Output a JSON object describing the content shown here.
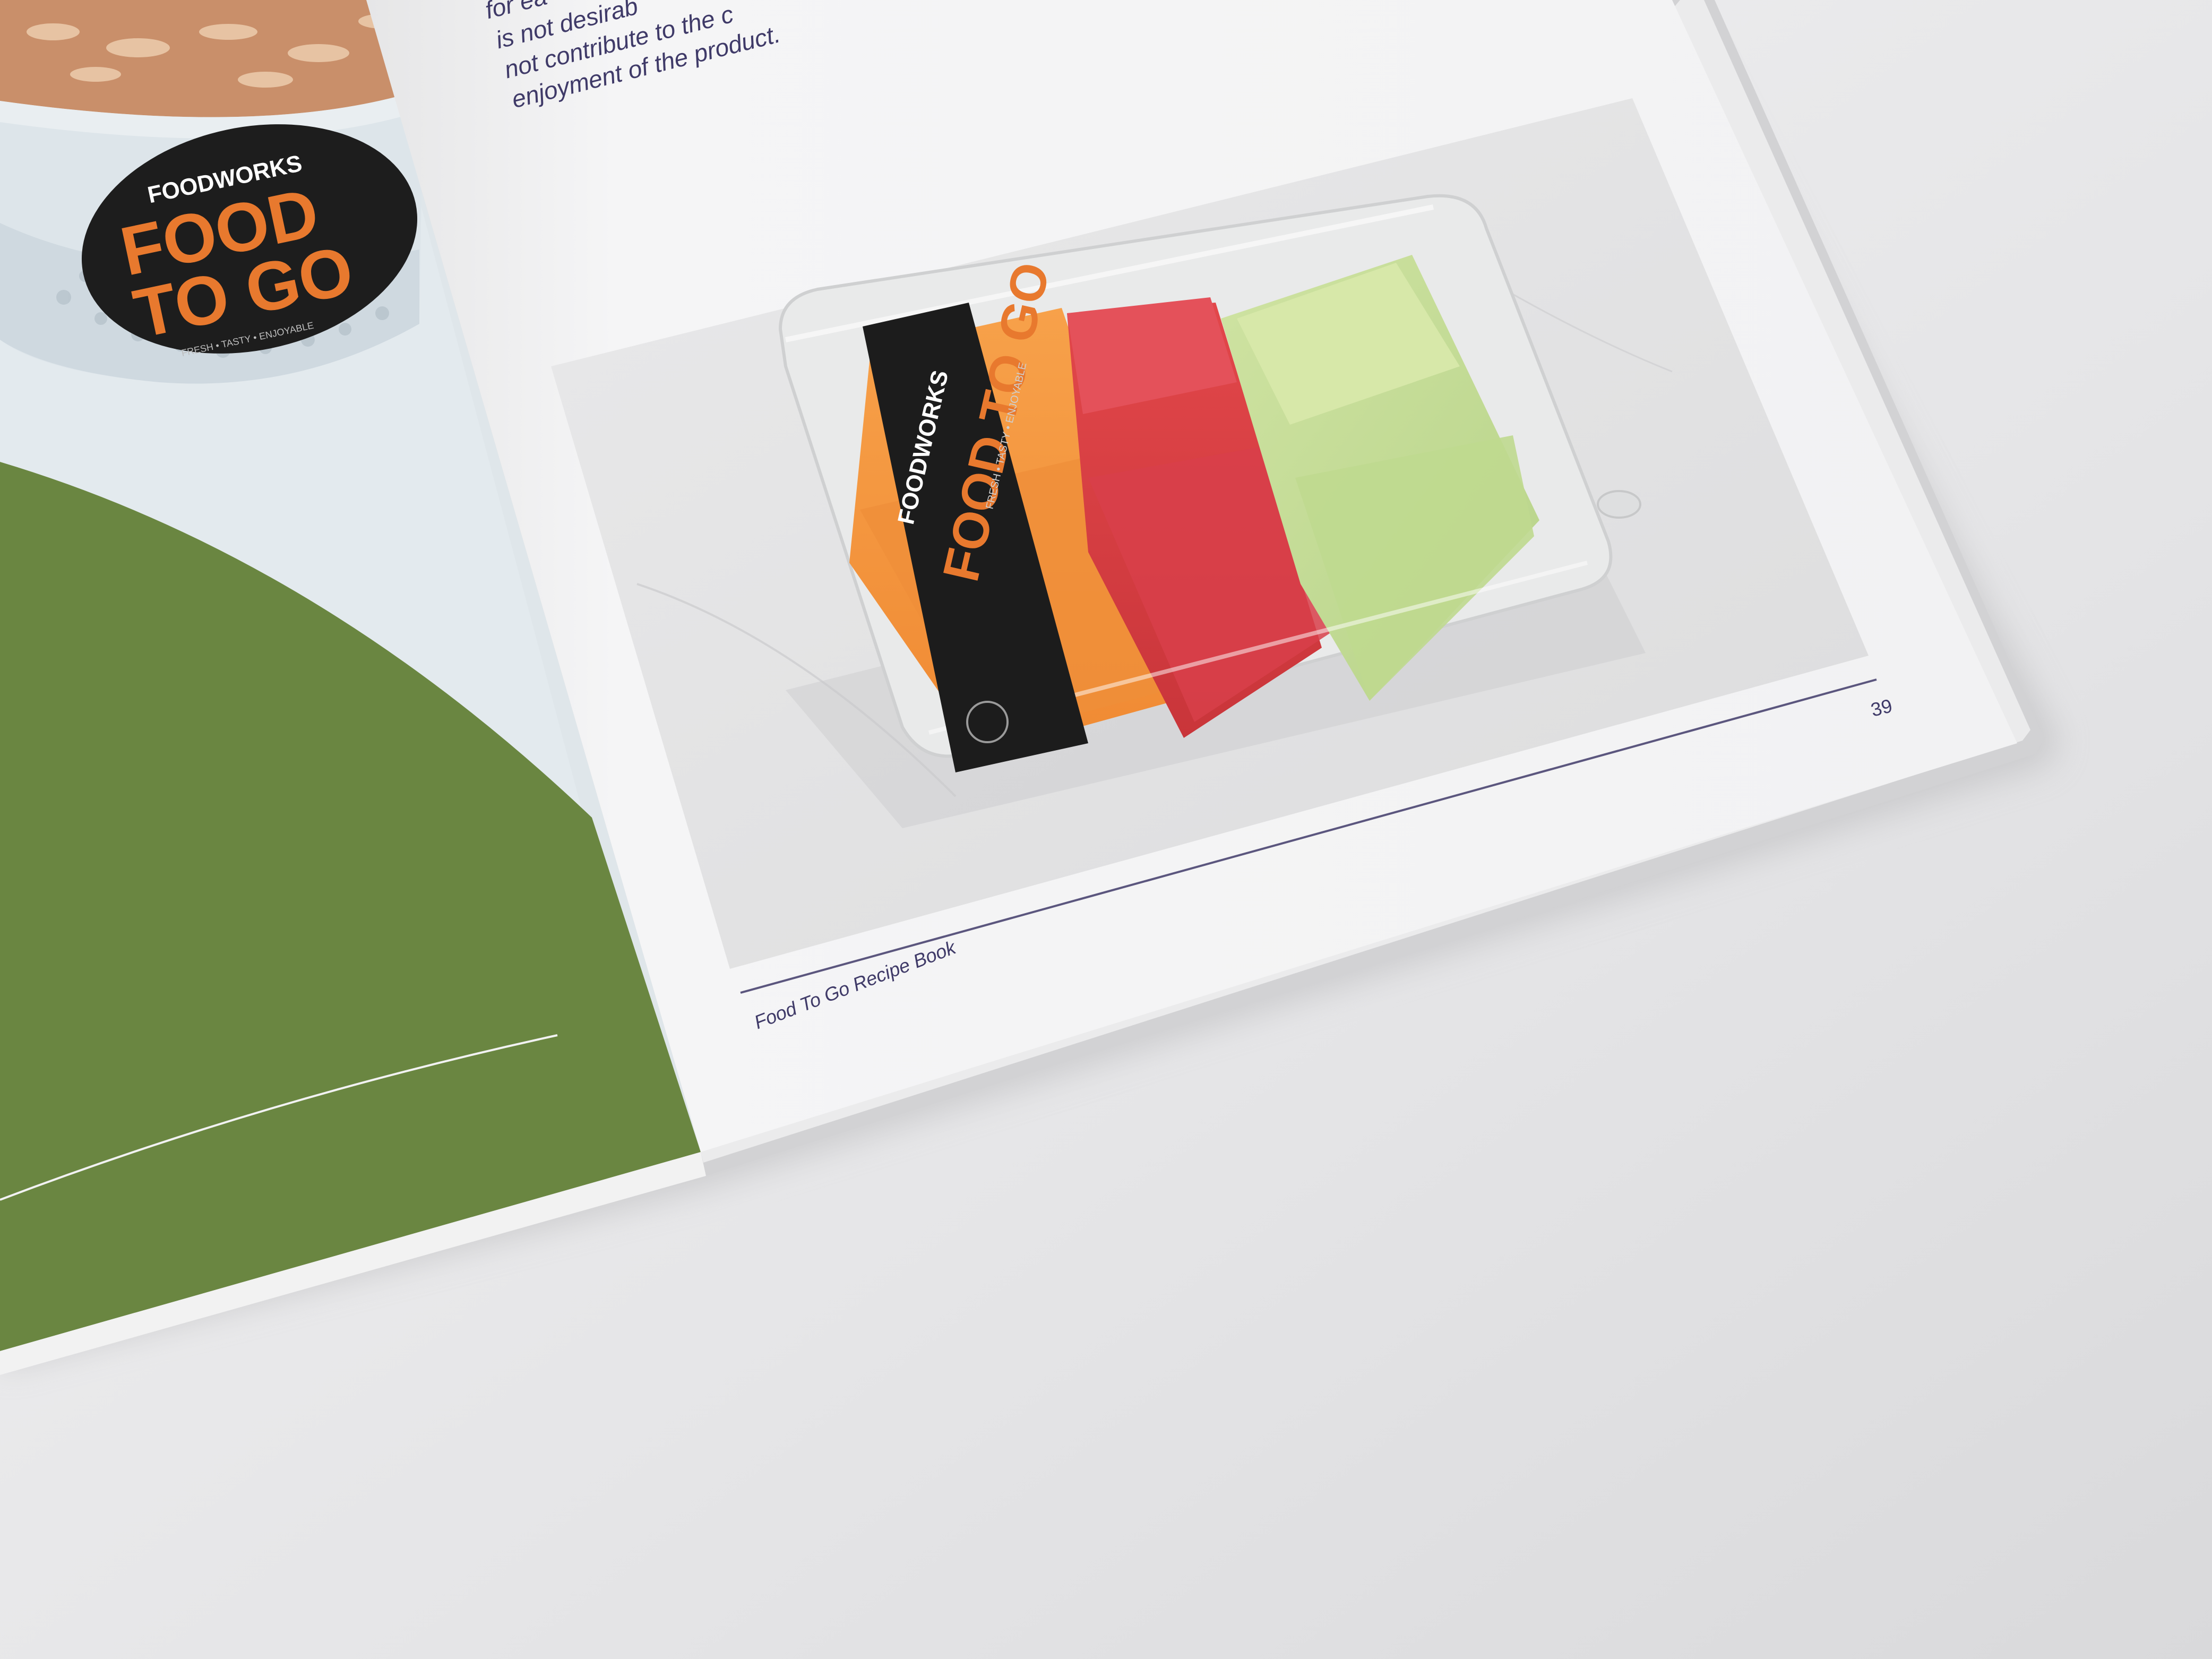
{
  "left_page": {
    "sticker": {
      "brand": "FOODWORKS",
      "line1": "FOOD",
      "line2": "TO GO",
      "tagline": "FRESH • TASTY • ENJOYABLE"
    }
  },
  "right_page": {
    "body_text_lines": [
      "for ea",
      "is not desirab",
      "not contribute to the c",
      "enjoyment of the product."
    ],
    "label": {
      "brand": "FOODWORKS",
      "title": "FOOD TO GO",
      "tagline": "FRESH • TASTY • ENJOYABLE"
    },
    "page_number": "39",
    "footer_title": "Food To Go Recipe Book"
  },
  "colors": {
    "background": "#e6e6e8",
    "page": "#f4f4f5",
    "green_panel": "#6a8641",
    "label_black": "#1c1c1c",
    "label_orange": "#e8792e",
    "text_navy": "#3f3a68"
  }
}
